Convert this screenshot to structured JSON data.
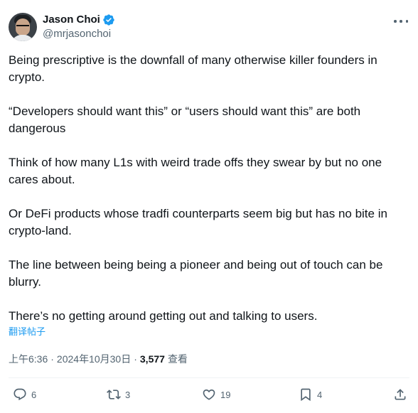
{
  "author": {
    "display_name": "Jason Choi",
    "handle": "@mrjasonchoi",
    "verified": true,
    "verified_color": "#1d9bf0"
  },
  "tweet": {
    "paragraphs": [
      "Being prescriptive is the downfall of many otherwise killer founders in crypto.",
      "“Developers should want this” or “users should want this” are both dangerous",
      "Think of how many L1s with weird trade offs they swear by but no one cares about.",
      "Or DeFi products whose tradfi counterparts seem big but has no bite in crypto-land.",
      "The line between being being a pioneer and being out of touch can be blurry.",
      "There’s no getting around getting out and  talking to users."
    ],
    "translate_label": "翻译帖子"
  },
  "meta": {
    "time": "上午6:36",
    "date": "2024年10月30日",
    "separator": "·",
    "views": "3,577",
    "views_label": "查看"
  },
  "actions": {
    "replies": "6",
    "retweets": "3",
    "likes": "19",
    "bookmarks": "4"
  },
  "icons": {
    "reply": "reply-icon",
    "retweet": "retweet-icon",
    "like": "heart-icon",
    "bookmark": "bookmark-icon",
    "share": "share-icon",
    "more": "more-icon",
    "verified": "verified-badge-icon"
  },
  "colors": {
    "text": "#0f1419",
    "secondary": "#536471",
    "link": "#1d9bf0"
  }
}
